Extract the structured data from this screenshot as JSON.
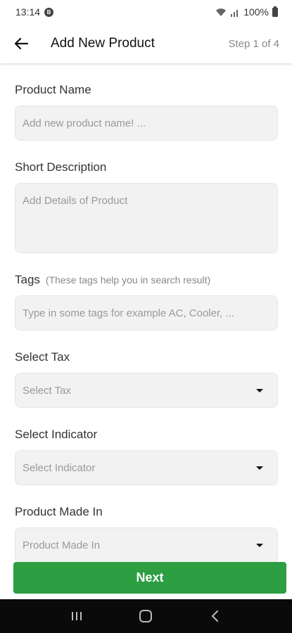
{
  "status_bar": {
    "time": "13:14",
    "notification_badge": "B",
    "battery": "100%"
  },
  "header": {
    "title": "Add New Product",
    "step": "Step 1 of 4"
  },
  "form": {
    "product_name": {
      "label": "Product Name",
      "placeholder": "Add new product name! ..."
    },
    "short_description": {
      "label": "Short Description",
      "placeholder": "Add Details of Product"
    },
    "tags": {
      "label": "Tags",
      "hint": "(These tags help you in search result)",
      "placeholder": "Type in some tags for example AC, Cooler, ..."
    },
    "tax": {
      "label": "Select Tax",
      "placeholder": "Select Tax"
    },
    "indicator": {
      "label": "Select Indicator",
      "placeholder": "Select Indicator"
    },
    "made_in": {
      "label": "Product Made In",
      "placeholder": "Product Made In"
    }
  },
  "footer": {
    "next_label": "Next"
  },
  "colors": {
    "primary": "#2e9e42",
    "field_bg": "#f2f2f2",
    "nav_bg": "#0a0a0a"
  }
}
